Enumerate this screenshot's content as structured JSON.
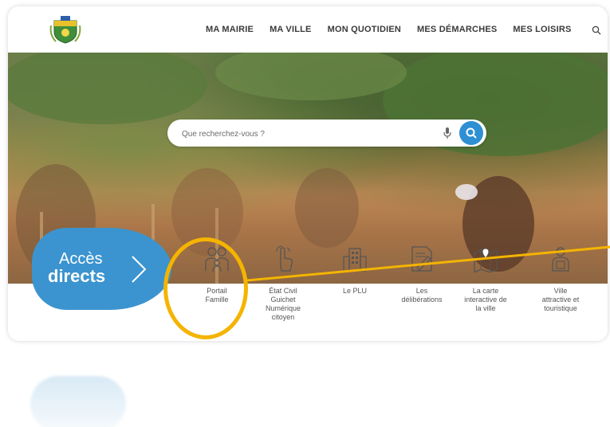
{
  "nav": {
    "items": [
      "MA MAIRIE",
      "MA VILLE",
      "MON QUOTIDIEN",
      "MES DÉMARCHES",
      "MES LOISIRS"
    ],
    "search_icon": "search-icon",
    "logo_icon": "city-crest-logo"
  },
  "search": {
    "placeholder": "Que recherchez-vous ?",
    "mic_icon": "microphone-icon",
    "button_icon": "search-icon",
    "button_color": "#2f8fd4"
  },
  "acces": {
    "line1": "Accès",
    "line2": "directs",
    "color": "#3b94cf"
  },
  "quick_links": [
    {
      "label_lines": [
        "Portail",
        "Famille"
      ],
      "icon": "family-icon"
    },
    {
      "label_lines": [
        "État Civil",
        "Guichet",
        "Numérique",
        "citoyen"
      ],
      "icon": "touch-icon"
    },
    {
      "label_lines": [
        "Le PLU"
      ],
      "icon": "building-icon"
    },
    {
      "label_lines": [
        "Les",
        "délibérations"
      ],
      "icon": "document-pen-icon"
    },
    {
      "label_lines": [
        "La carte",
        "interactive de",
        "la ville"
      ],
      "icon": "map-icon"
    },
    {
      "label_lines": [
        "Ville",
        "attractive et",
        "touristique"
      ],
      "icon": "traveler-icon"
    }
  ],
  "highlight": {
    "color": "#f4b400"
  }
}
